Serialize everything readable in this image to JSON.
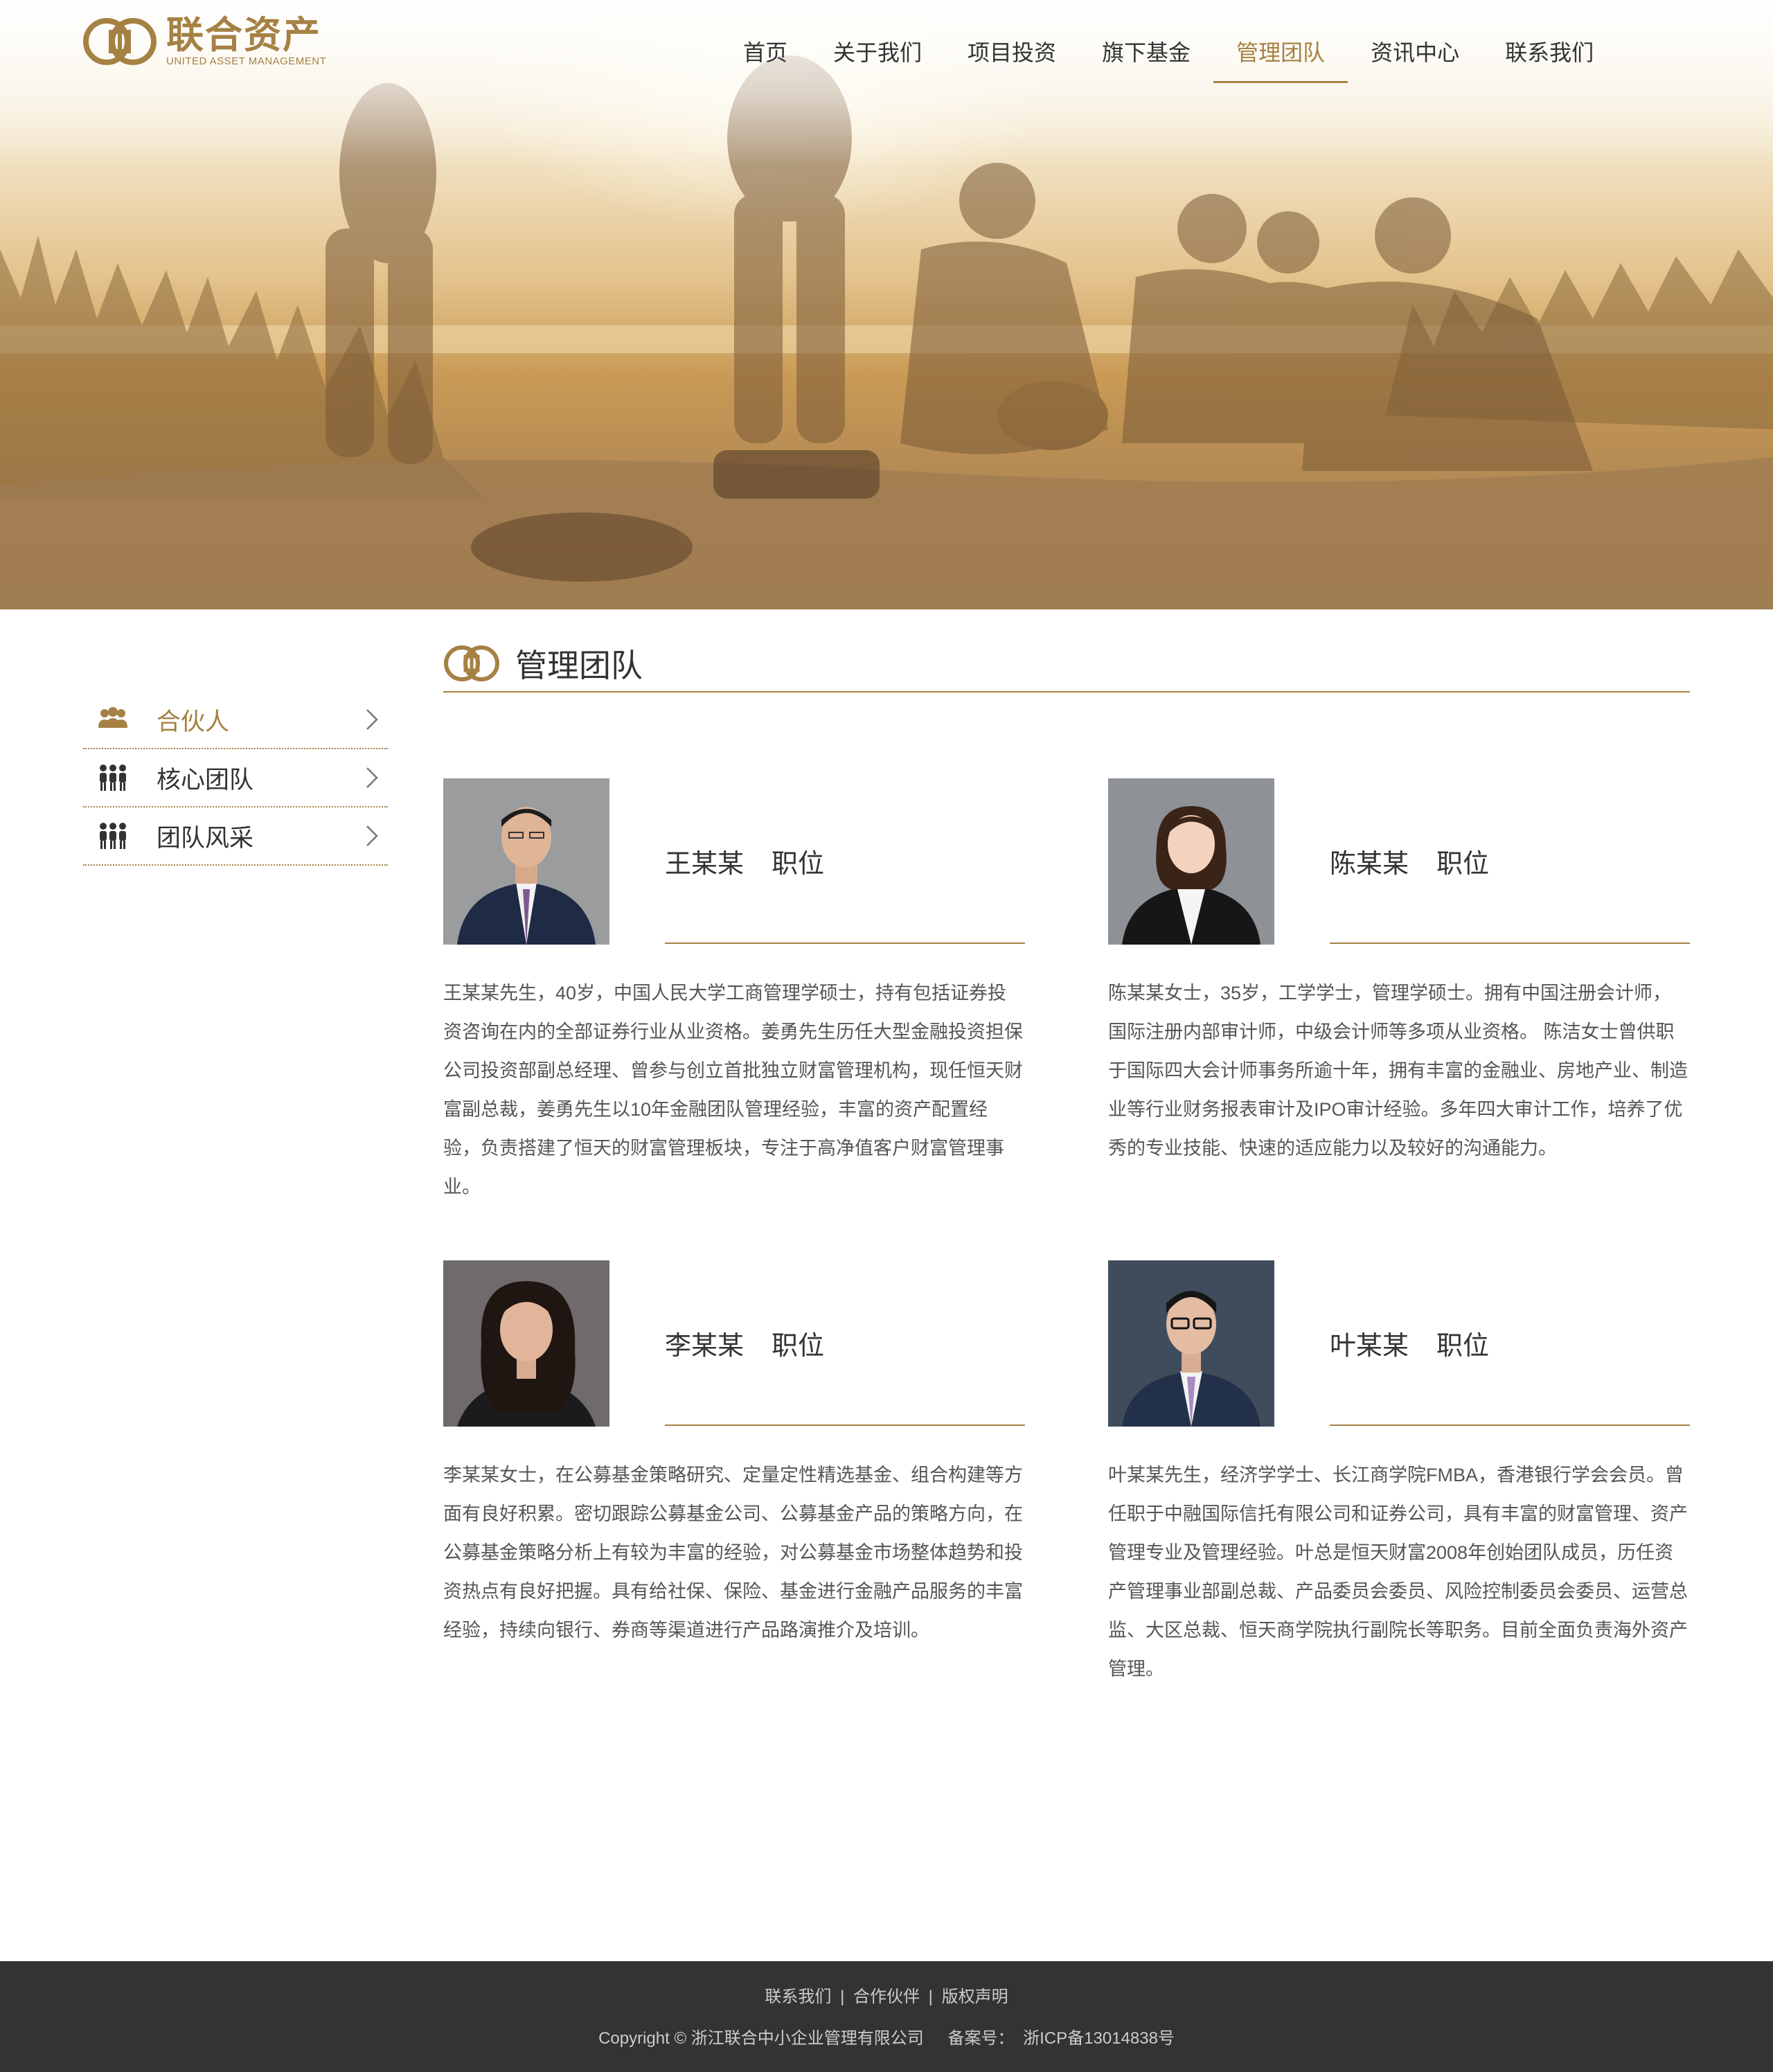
{
  "brand": {
    "name_cn": "联合资产",
    "name_en": "UNITED ASSET MANAGEMENT",
    "logo_icon": "linked-rings-logo-icon",
    "color": "#a58143"
  },
  "nav": {
    "items": [
      {
        "label": "首页"
      },
      {
        "label": "关于我们"
      },
      {
        "label": "项目投资"
      },
      {
        "label": "旗下基金"
      },
      {
        "label": "管理团队",
        "active": true
      },
      {
        "label": "资讯中心"
      },
      {
        "label": "联系我们"
      }
    ]
  },
  "hero": {
    "image": "friends-on-beach-sunset-photo"
  },
  "sidebar": {
    "items": [
      {
        "label": "合伙人",
        "icon": "group-icon",
        "active": true
      },
      {
        "label": "核心团队",
        "icon": "team-icon"
      },
      {
        "label": "团队风采",
        "icon": "team-icon"
      }
    ]
  },
  "section": {
    "title": "管理团队",
    "icon": "linked-rings-icon"
  },
  "members": [
    {
      "name": "王某某",
      "position": "职位",
      "photo": "man-portrait-photo",
      "bio": "王某某先生，40岁，中国人民大学工商管理学硕士，持有包括证券投资咨询在内的全部证券行业从业资格。姜勇先生历任大型金融投资担保公司投资部副总经理、曾参与创立首批独立财富管理机构，现任恒天财富副总裁，姜勇先生以10年金融团队管理经验，丰富的资产配置经验，负责搭建了恒天的财富管理板块，专注于高净值客户财富管理事业。"
    },
    {
      "name": "陈某某",
      "position": "职位",
      "photo": "woman-portrait-photo",
      "bio": "陈某某女士，35岁，工学学士，管理学硕士。拥有中国注册会计师，国际注册内部审计师，中级会计师等多项从业资格。 陈洁女士曾供职于国际四大会计师事务所逾十年，拥有丰富的金融业、房地产业、制造业等行业财务报表审计及IPO审计经验。多年四大审计工作，培养了优秀的专业技能、快速的适应能力以及较好的沟通能力。"
    },
    {
      "name": "李某某",
      "position": "职位",
      "photo": "woman-portrait-photo",
      "bio": "李某某女士，在公募基金策略研究、定量定性精选基金、组合构建等方面有良好积累。密切跟踪公募基金公司、公募基金产品的策略方向，在公募基金策略分析上有较为丰富的经验，对公募基金市场整体趋势和投资热点有良好把握。具有给社保、保险、基金进行金融产品服务的丰富经验，持续向银行、券商等渠道进行产品路演推介及培训。"
    },
    {
      "name": "叶某某",
      "position": "职位",
      "photo": "man-with-glasses-portrait-photo",
      "bio": "叶某某先生，经济学学士、长江商学院FMBA，香港银行学会会员。曾任职于中融国际信托有限公司和证券公司，具有丰富的财富管理、资产管理专业及管理经验。叶总是恒天财富2008年创始团队成员，历任资产管理事业部副总裁、产品委员会委员、风险控制委员会委员、运营总监、大区总裁、恒天商学院执行副院长等职务。目前全面负责海外资产管理。"
    }
  ],
  "footer": {
    "links": [
      {
        "label": "联系我们"
      },
      {
        "label": "合作伙伴"
      },
      {
        "label": "版权声明"
      }
    ],
    "separator": "|",
    "copyright": "Copyright © 浙江联合中小企业管理有限公司",
    "icp_label": "备案号：",
    "icp_number": "浙ICP备13014838号"
  }
}
